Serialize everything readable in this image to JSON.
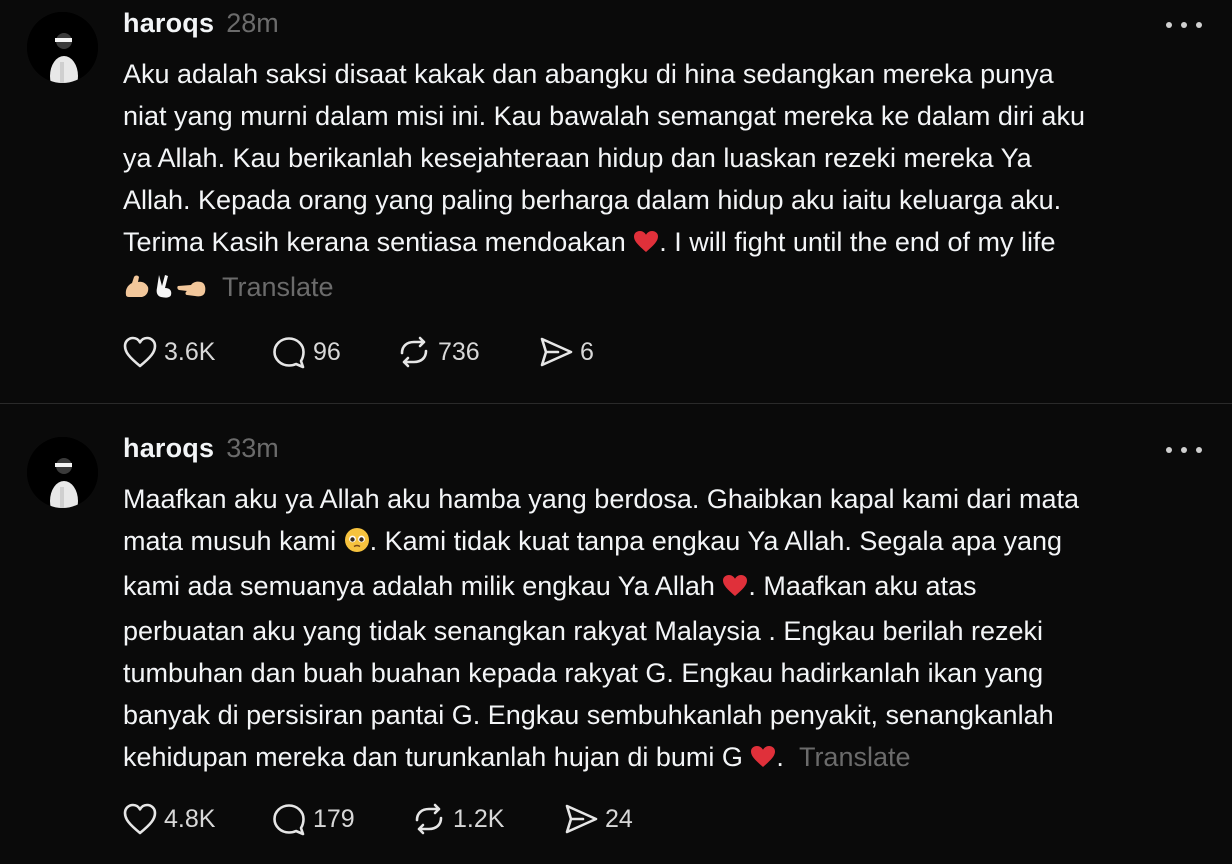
{
  "posts": [
    {
      "username": "haroqs",
      "time": "28m",
      "lines": [
        "Aku adalah saksi disaat kakak dan abangku di hina sedangkan mereka punya",
        "niat yang murni dalam misi ini. Kau bawalah semangat mereka ke dalam diri aku",
        "ya Allah. Kau berikanlah kesejahteraan hidup dan luaskan rezeki mereka Ya",
        "Allah. Kepada orang yang paling berharga dalam hidup aku iaitu keluarga aku."
      ],
      "line5_before": "Terima Kasih kerana sentiasa mendoakan ",
      "line5_after": ". I will fight until the end of my life",
      "translate": "Translate",
      "likes": "3.6K",
      "replies": "96",
      "reposts": "736",
      "shares": "6"
    },
    {
      "username": "haroqs",
      "time": "33m",
      "line1": "Maafkan aku ya Allah aku hamba yang berdosa. Ghaibkan kapal kami dari mata",
      "line2_before": "mata musuh kami ",
      "line2_after": ". Kami tidak kuat tanpa engkau Ya Allah. Segala apa yang",
      "line3_before": "kami ada semuanya adalah milik engkau Ya Allah ",
      "line3_after": ". Maafkan aku atas",
      "lines_mid": [
        "perbuatan aku yang tidak senangkan rakyat Malaysia . Engkau berilah rezeki",
        "tumbuhan dan buah buahan kepada rakyat G. Engkau hadirkanlah ikan yang",
        "banyak di persisiran pantai G. Engkau sembuhkanlah penyakit, senangkanlah"
      ],
      "line8_before": "kehidupan mereka dan turunkanlah hujan di bumi G ",
      "line8_after": ".",
      "translate": "Translate",
      "likes": "4.8K",
      "replies": "179",
      "reposts": "1.2K",
      "shares": "24"
    }
  ],
  "icons": {
    "like": "heart-icon",
    "reply": "comment-icon",
    "repost": "repost-icon",
    "share": "share-icon",
    "more": "more-icon"
  },
  "colors": {
    "background": "#0a0a0a",
    "text": "#f3f5f7",
    "muted": "#6b6b6b",
    "heart_emoji": "#e0303a"
  }
}
